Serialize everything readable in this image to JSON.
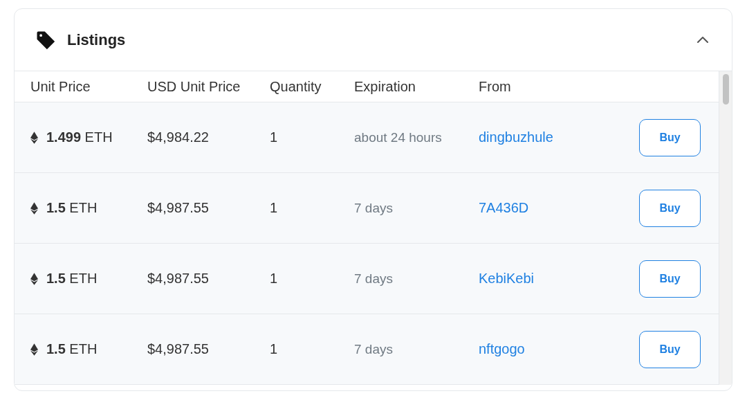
{
  "panel": {
    "title": "Listings",
    "expanded": true
  },
  "table": {
    "columns": [
      "Unit Price",
      "USD Unit Price",
      "Quantity",
      "Expiration",
      "From"
    ],
    "rows": [
      {
        "price": "**1.499** ETH",
        "usd": "$4,984.22",
        "quantity": "1",
        "expiration": "about 24 hours",
        "from": "dingbuzhule",
        "action": "Buy"
      },
      {
        "price": "**1.5** ETH",
        "usd": "$4,987.55",
        "quantity": "1",
        "expiration": "7 days",
        "from": "7A436D",
        "action": "Buy"
      },
      {
        "price": "**1.5** ETH",
        "usd": "$4,987.55",
        "quantity": "1",
        "expiration": "7 days",
        "from": "KebiKebi",
        "action": "Buy"
      },
      {
        "price": "**1.5** ETH",
        "usd": "$4,987.55",
        "quantity": "1",
        "expiration": "7 days",
        "from": "nftgogo",
        "action": "Buy"
      }
    ]
  }
}
